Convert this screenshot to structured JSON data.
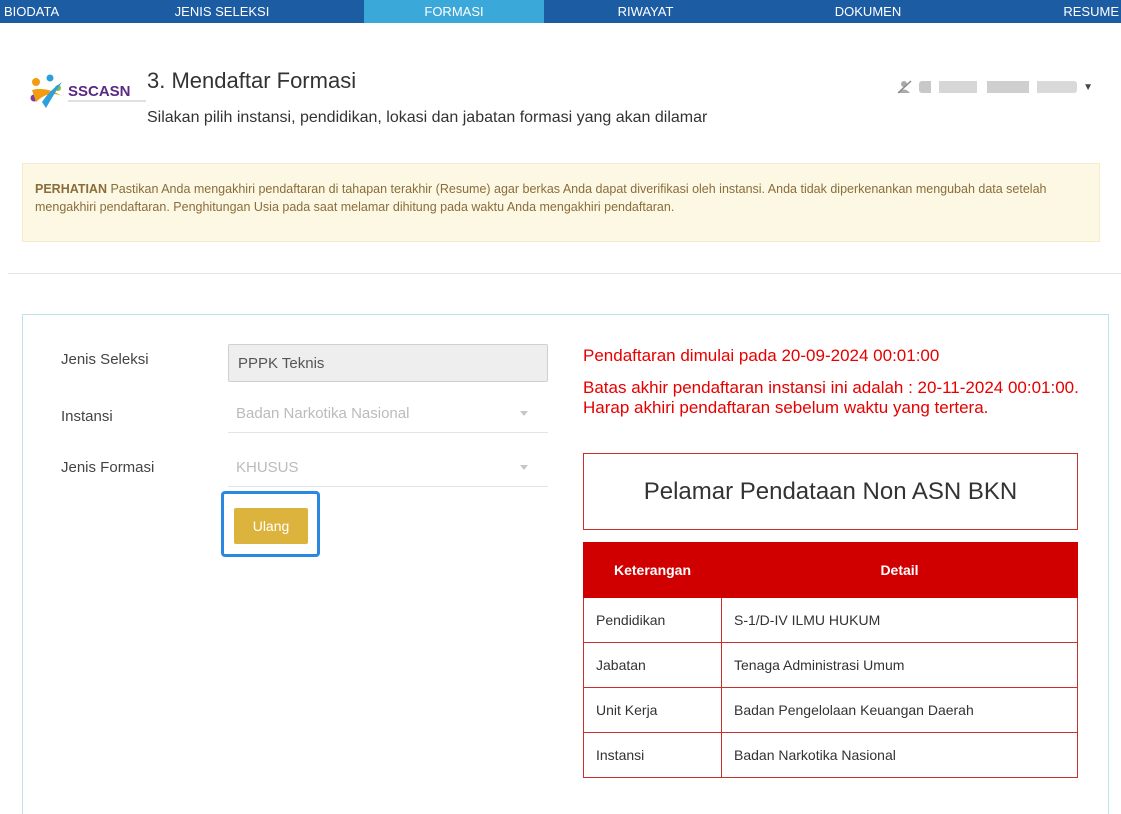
{
  "nav": {
    "tabs": [
      {
        "label": "BIODATA",
        "active": false
      },
      {
        "label": "JENIS SELEKSI",
        "active": false
      },
      {
        "label": "FORMASI",
        "active": true
      },
      {
        "label": "RIWAYAT",
        "active": false
      },
      {
        "label": "DOKUMEN",
        "active": false
      },
      {
        "label": "RESUME",
        "active": false
      }
    ]
  },
  "header": {
    "logo_text": "SSCASN",
    "title": "3. Mendaftar Formasi",
    "subtitle": "Silakan pilih instansi, pendidikan, lokasi dan jabatan formasi yang akan dilamar",
    "user_icon": "user-off-icon"
  },
  "alert": {
    "strong": "PERHATIAN",
    "text": " Pastikan Anda mengakhiri pendaftaran di tahapan terakhir (Resume) agar berkas Anda dapat diverifikasi oleh instansi. Anda tidak diperkenankan mengubah data setelah mengakhiri pendaftaran. Penghitungan Usia pada saat melamar dihitung pada waktu Anda mengakhiri pendaftaran."
  },
  "form": {
    "jenis_seleksi_label": "Jenis Seleksi",
    "jenis_seleksi_value": "PPPK Teknis",
    "instansi_label": "Instansi",
    "instansi_value": "Badan Narkotika Nasional",
    "jenis_formasi_label": "Jenis Formasi",
    "jenis_formasi_value": "KHUSUS",
    "button_label": "Ulang"
  },
  "info": {
    "start_notice": "Pendaftaran dimulai pada 20-09-2024 00:01:00",
    "deadline_notice": "Batas akhir pendaftaran instansi ini adalah : 20-11-2024 00:01:00. Harap akhiri pendaftaran sebelum waktu yang tertera.",
    "box_title": "Pelamar Pendataan Non ASN BKN"
  },
  "detail_table": {
    "headers": [
      "Keterangan",
      "Detail"
    ],
    "rows": [
      [
        "Pendidikan",
        "S-1/D-IV ILMU HUKUM"
      ],
      [
        "Jabatan",
        "Tenaga Administrasi Umum"
      ],
      [
        "Unit Kerja",
        "Badan Pengelolaan Keuangan Daerah"
      ],
      [
        "Instansi",
        "Badan Narkotika Nasional"
      ]
    ]
  },
  "colors": {
    "nav_bg": "#1b5ca3",
    "nav_active": "#3ba8da",
    "alert_bg": "#fcf8e3",
    "notice_red": "#e60000",
    "table_header": "#d00000",
    "button": "#dcb33c",
    "focus_outline": "#2b88e0"
  }
}
